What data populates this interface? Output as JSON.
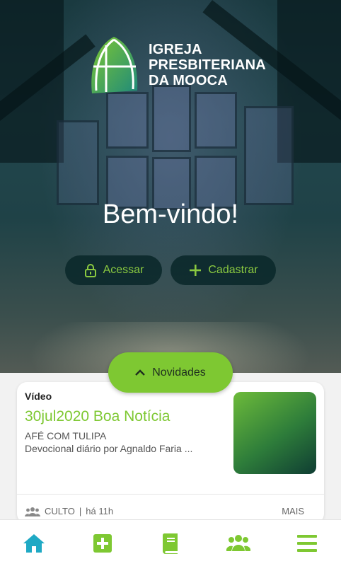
{
  "logo": {
    "line1": "IGREJA",
    "line2": "PRESBITERIANA",
    "line3": "DA MOOCA"
  },
  "welcome_text": "Bem-vindo!",
  "auth": {
    "login_label": "Acessar",
    "signup_label": "Cadastrar"
  },
  "news_button_label": "Novidades",
  "card": {
    "type": "Vídeo",
    "title": "30jul2020 Boa Notícia",
    "subtitle": "AFÉ COM TULIPA",
    "description": "Devocional diário por Agnaldo Faria ...",
    "category": "CULTO",
    "time": "há 11h",
    "more_label": "MAIS"
  },
  "tabbar": {
    "items": [
      "home-icon",
      "add-icon",
      "book-icon",
      "group-icon",
      "menu-icon"
    ],
    "active_color": "#1fa9c4",
    "icon_color": "#7ec832"
  },
  "colors": {
    "accent": "#7ec832",
    "active_tab": "#1fa9c4"
  }
}
